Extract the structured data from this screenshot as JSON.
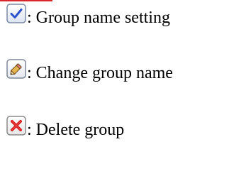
{
  "colors": {
    "accent_rule": "#d9262a",
    "check_blue": "#2b52c8",
    "delete_red": "#d61f1f"
  },
  "legend": [
    {
      "icon": "checkbox-check-icon",
      "text": ": Group name setting"
    },
    {
      "icon": "pencil-edit-icon",
      "text": ": Change group name"
    },
    {
      "icon": "delete-x-icon",
      "text": ": Delete group"
    }
  ]
}
